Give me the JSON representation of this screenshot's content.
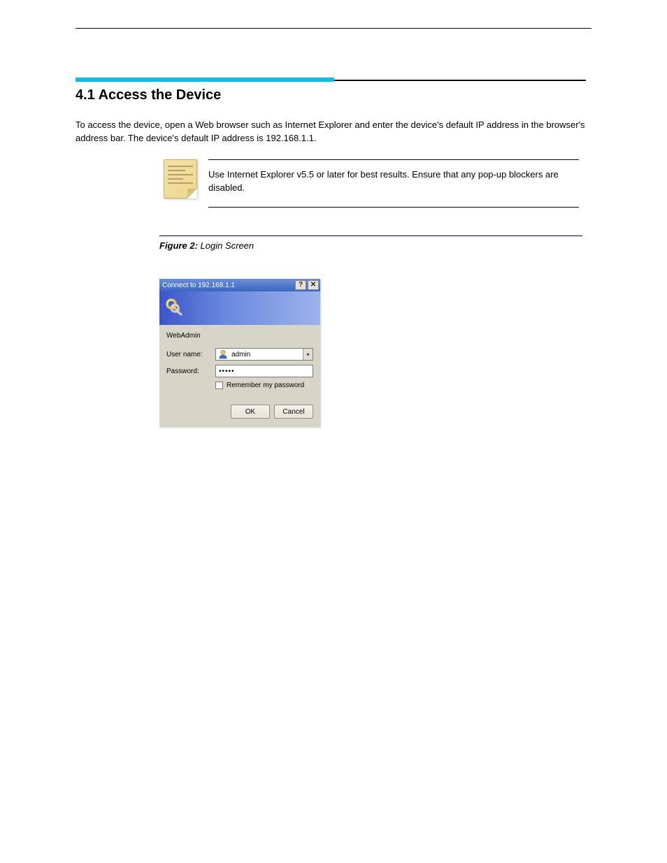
{
  "section": {
    "heading": "4.1  Access the Device",
    "paragraph": "To access the device, open a Web browser such as Internet Explorer and enter the device's default IP address in the browser's address bar. The device's default IP address is 192.168.1.1.",
    "note": "Use Internet Explorer v5.5 or later for best results. Ensure that any pop-up blockers are disabled."
  },
  "figure": {
    "label": "Figure 2:",
    "caption": "Login Screen"
  },
  "dialog": {
    "title": "Connect to 192.168.1.1",
    "help_btn": "?",
    "close_btn": "✕",
    "realm": "WebAdmin",
    "username_label": "User name:",
    "username_value": "admin",
    "password_label": "Password:",
    "password_mask": "•••••",
    "remember_label": "Remember my password",
    "ok_btn": "OK",
    "cancel_btn": "Cancel"
  }
}
